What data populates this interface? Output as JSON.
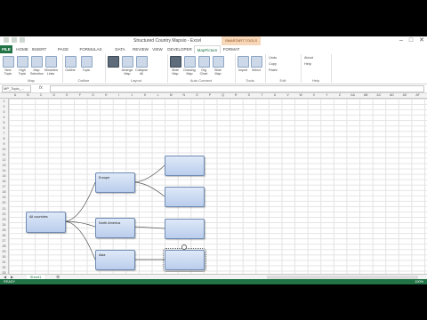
{
  "window": {
    "title": "Structured Country Mapsio - Excel",
    "context_tab_header": "SMARTART TOOLS",
    "controls": [
      "–",
      "□",
      "✕"
    ],
    "user": "Chris Menard"
  },
  "tabs": [
    "FILE",
    "HOME",
    "INSERT",
    "PAGE LAYOUT",
    "FORMULAS",
    "DATA",
    "REVIEW",
    "VIEW",
    "DEVELOPER",
    "MapPicture",
    "FORMAT"
  ],
  "active_tab": "MapPicture",
  "ribbon": {
    "groups": [
      {
        "label": "Map",
        "buttons": [
          "New Topic",
          "High Topic",
          "Map Selection",
          "Mindview Links"
        ]
      },
      {
        "label": "Outline",
        "buttons": [
          "Outline",
          "Topic"
        ]
      },
      {
        "label": "Layout",
        "buttons": [
          "Arrange Map",
          "Collapse All"
        ]
      },
      {
        "label": "Auto Connect",
        "buttons": [
          "Slide Map",
          "Drawing Map",
          "Org Chart",
          "Slide Map"
        ]
      },
      {
        "label": "Tools",
        "buttons": [
          "Import",
          "Select"
        ]
      },
      {
        "label": "Edit",
        "buttons": [
          "Undo",
          "Copy",
          "Paste"
        ]
      },
      {
        "label": "Help",
        "buttons": [
          "About",
          "Help"
        ]
      }
    ]
  },
  "formula_bar": {
    "name_box": "MP_Topic_...",
    "fx": "fx",
    "value": ""
  },
  "columns": [
    "A",
    "B",
    "C",
    "D",
    "E",
    "F",
    "G",
    "H",
    "I",
    "J",
    "K",
    "L",
    "M",
    "N",
    "O",
    "P",
    "Q",
    "R",
    "S",
    "T",
    "U",
    "V",
    "W",
    "X",
    "Y",
    "Z",
    "AA",
    "AB",
    "AC",
    "AD",
    "AE",
    "AF"
  ],
  "rows": [
    "1",
    "2",
    "3",
    "4",
    "5",
    "6",
    "7",
    "8",
    "9",
    "10",
    "11",
    "12",
    "13",
    "14",
    "15",
    "16",
    "17",
    "18",
    "19",
    "20",
    "21",
    "22",
    "23",
    "24",
    "25",
    "26",
    "27",
    "28",
    "29",
    "30",
    "31",
    "32",
    "33"
  ],
  "diagram": {
    "root": "All countries",
    "branches": [
      "Europe",
      "North America",
      "Asia"
    ],
    "leaves": [
      "",
      "",
      "",
      ""
    ]
  },
  "sheet_tab": "Sheet1",
  "status": {
    "left": "READY",
    "zoom": "100%"
  }
}
